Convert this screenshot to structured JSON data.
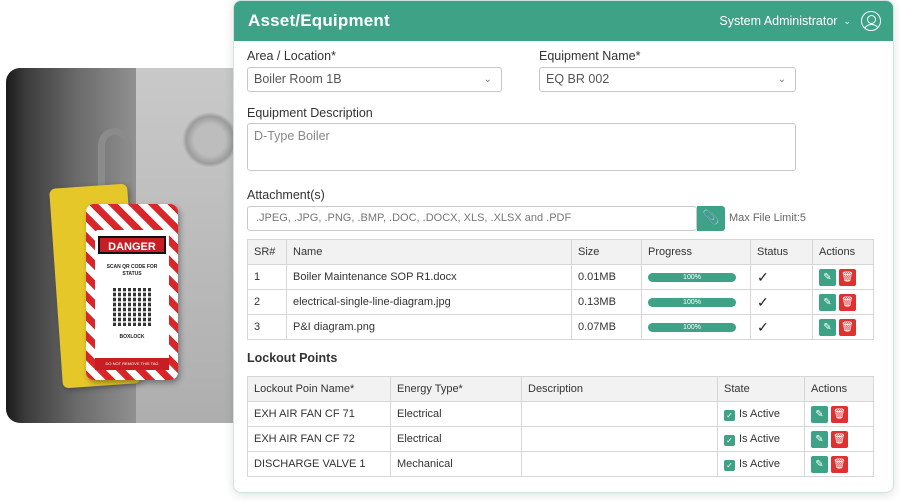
{
  "header": {
    "title": "Asset/Equipment",
    "user_name": "System Administrator"
  },
  "form": {
    "area_label": "Area / Location*",
    "area_value": "Boiler Room 1B",
    "equipment_label": "Equipment Name*",
    "equipment_value": "EQ BR 002",
    "description_label": "Equipment Description",
    "description_value": "D-Type Boiler",
    "attachment_label": "Attachment(s)",
    "attachment_placeholder": ".JPEG, .JPG, .PNG, .BMP, .DOC, .DOCX, XLS, .XLSX and .PDF",
    "file_limit": "Max File Limit:5"
  },
  "attachments": {
    "headers": [
      "SR#",
      "Name",
      "Size",
      "Progress",
      "Status",
      "Actions"
    ],
    "rows": [
      {
        "sr": "1",
        "name": "Boiler Maintenance SOP R1.docx",
        "size": "0.01MB",
        "progress": "100%"
      },
      {
        "sr": "2",
        "name": "electrical-single-line-diagram.jpg",
        "size": "0.13MB",
        "progress": "100%"
      },
      {
        "sr": "3",
        "name": "P&I diagram.png",
        "size": "0.07MB",
        "progress": "100%"
      }
    ]
  },
  "lockout": {
    "title": "Lockout Points",
    "headers": [
      "Lockout Poin Name*",
      "Energy Type*",
      "Description",
      "State",
      "Actions"
    ],
    "rows": [
      {
        "name": "EXH AIR FAN CF 71",
        "energy": "Electrical",
        "description": "",
        "state": "Is Active"
      },
      {
        "name": "EXH AIR FAN CF 72",
        "energy": "Electrical",
        "description": "",
        "state": "Is Active"
      },
      {
        "name": "DISCHARGE VALVE 1",
        "energy": "Mechanical",
        "description": "",
        "state": "Is Active"
      }
    ]
  },
  "photo_tag": {
    "danger": "DANGER",
    "scan_text": "SCAN QR CODE FOR STATUS",
    "brand": "BOXLOCK",
    "footer": "DO NOT REMOVE THIS TAG"
  },
  "colors": {
    "accent": "#3ea287",
    "delete": "#e03131"
  }
}
